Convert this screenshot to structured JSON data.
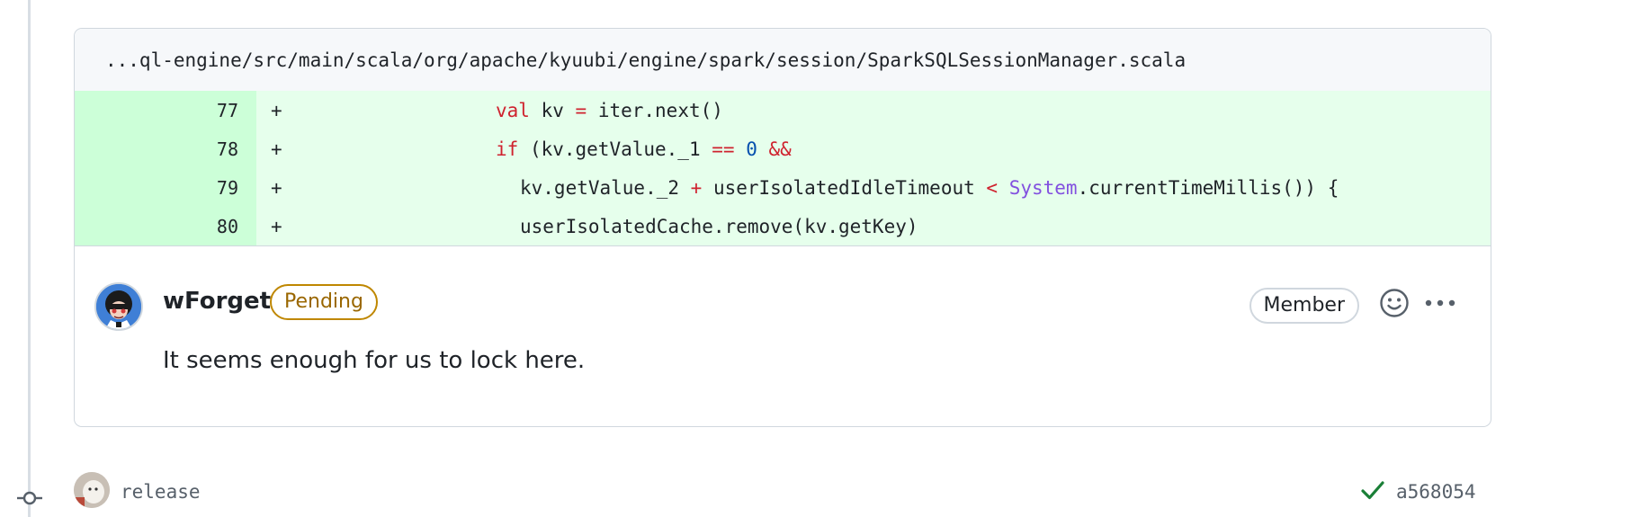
{
  "file": {
    "path": "...ql-engine/src/main/scala/org/apache/kyuubi/engine/spark/session/SparkSQLSessionManager.scala"
  },
  "diff": {
    "lines": [
      {
        "num": "77",
        "marker": "+",
        "indent": 0,
        "tokens": [
          {
            "text": "val",
            "cls": "kw"
          },
          {
            "text": " kv ",
            "cls": ""
          },
          {
            "text": "=",
            "cls": "kw"
          },
          {
            "text": " iter.next()",
            "cls": ""
          }
        ]
      },
      {
        "num": "78",
        "marker": "+",
        "indent": 0,
        "tokens": [
          {
            "text": "if",
            "cls": "kw"
          },
          {
            "text": " (kv.getValue._1 ",
            "cls": ""
          },
          {
            "text": "==",
            "cls": "kw"
          },
          {
            "text": " ",
            "cls": ""
          },
          {
            "text": "0",
            "cls": "num"
          },
          {
            "text": " ",
            "cls": ""
          },
          {
            "text": "&&",
            "cls": "kw"
          }
        ]
      },
      {
        "num": "79",
        "marker": "+",
        "indent": 1,
        "tokens": [
          {
            "text": "kv.getValue._2 ",
            "cls": ""
          },
          {
            "text": "+",
            "cls": "kw"
          },
          {
            "text": " userIsolatedIdleTimeout ",
            "cls": ""
          },
          {
            "text": "<",
            "cls": "kw"
          },
          {
            "text": " ",
            "cls": ""
          },
          {
            "text": "System",
            "cls": "sys"
          },
          {
            "text": ".currentTimeMillis()) {",
            "cls": ""
          }
        ]
      },
      {
        "num": "80",
        "marker": "+",
        "indent": 1,
        "tokens": [
          {
            "text": "userIsolatedCache.remove(kv.getKey)",
            "cls": ""
          }
        ]
      }
    ]
  },
  "comment": {
    "author": "wForget",
    "status_badge": "Pending",
    "role_badge": "Member",
    "body": "It seems enough for us to lock here.",
    "reaction_icon": "smiley-icon",
    "menu_icon": "kebab-horizontal-icon"
  },
  "commit": {
    "author": "release",
    "sha": "a568054",
    "status_icon": "check-icon",
    "status_color": "#1a7f37"
  },
  "colors": {
    "addition_num_bg": "#ccffd8",
    "addition_code_bg": "#e6ffec",
    "keyword": "#cf222e",
    "number": "#0550ae",
    "type": "#8250df",
    "pending": "#bf8700"
  }
}
